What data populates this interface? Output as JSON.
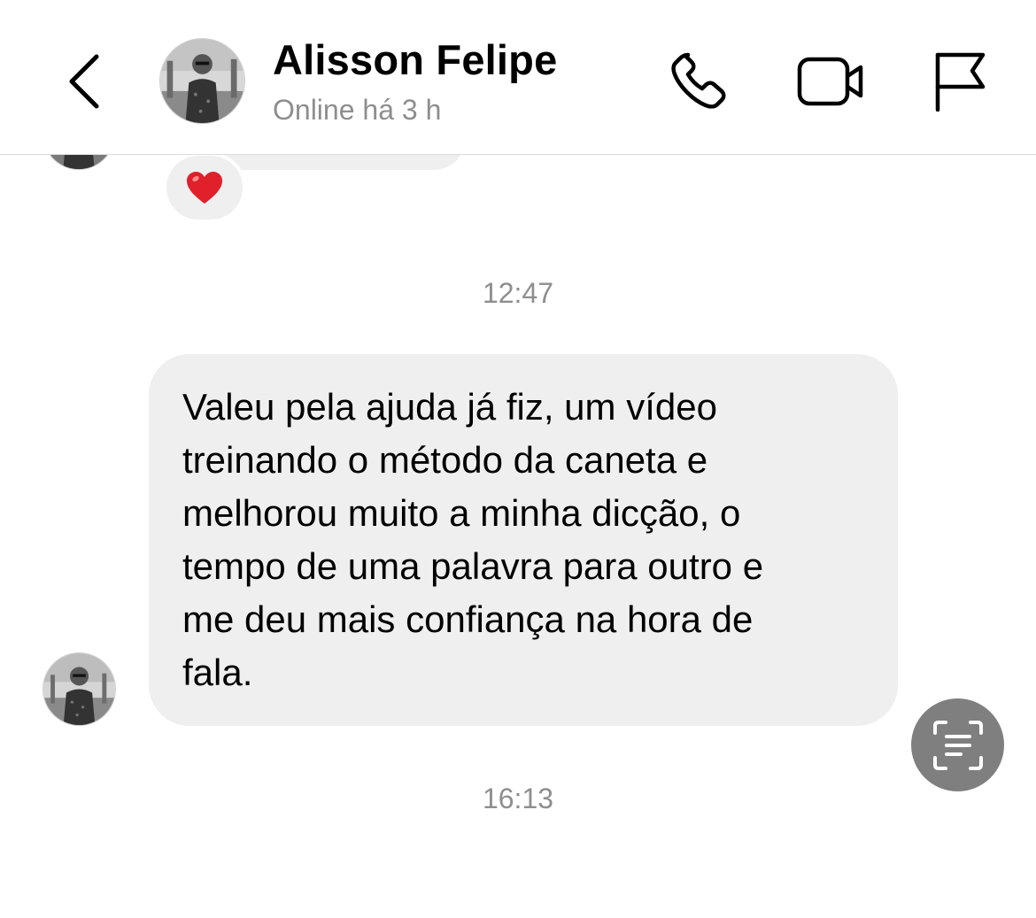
{
  "header": {
    "contact_name": "Alisson Felipe",
    "status": "Online há 3 h",
    "icons": {
      "back": "chevron-left-icon",
      "call": "phone-icon",
      "video": "video-camera-icon",
      "report": "flag-icon"
    }
  },
  "thread": {
    "previous_reaction": "❤️",
    "timestamps": [
      "12:47",
      "16:13"
    ],
    "message": {
      "text": "Valeu pela ajuda já fiz, um vídeo\ntreinando o método da caneta e\nmelhorou muito a minha dicção, o\ntempo de uma palavra para outro e\nme deu mais confiança na hora de\nfala."
    },
    "scan_button_icon": "text-scan-icon"
  },
  "colors": {
    "bubble": "#efefef",
    "secondary_text": "#8e8e8e",
    "scan_button": "#7f7f7f",
    "heart": "#e0202a"
  }
}
